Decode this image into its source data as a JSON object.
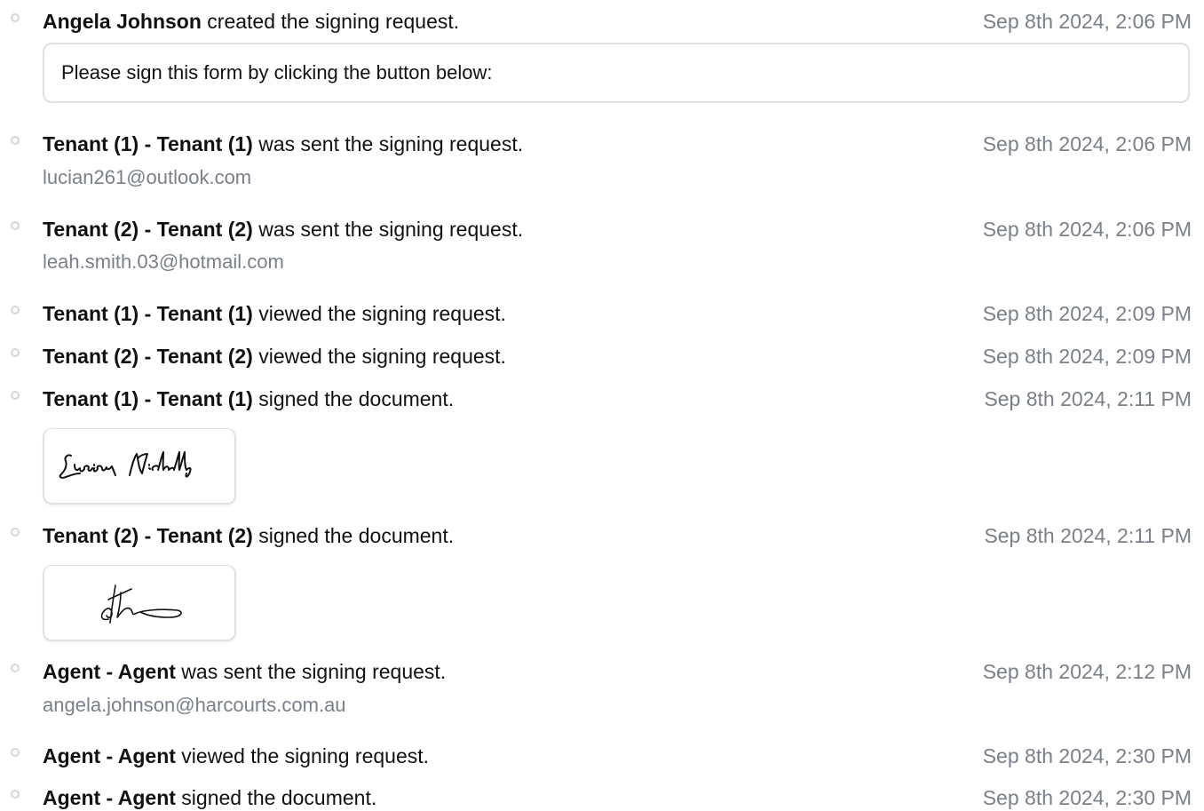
{
  "events": [
    {
      "actor": "Angela Johnson",
      "action": "created the signing request.",
      "time": "Sep 8th 2024, 2:06 PM",
      "message": "Please sign this form by clicking the button below:"
    },
    {
      "actor": "Tenant (1) - Tenant (1)",
      "action": "was sent the signing request.",
      "time": "Sep 8th 2024, 2:06 PM",
      "email": "lucian261@outlook.com"
    },
    {
      "actor": "Tenant (2) - Tenant (2)",
      "action": "was sent the signing request.",
      "time": "Sep 8th 2024, 2:06 PM",
      "email": "leah.smith.03@hotmail.com"
    },
    {
      "actor": "Tenant (1) - Tenant (1)",
      "action": "viewed the signing request.",
      "time": "Sep 8th 2024, 2:09 PM"
    },
    {
      "actor": "Tenant (2) - Tenant (2)",
      "action": "viewed the signing request.",
      "time": "Sep 8th 2024, 2:09 PM"
    },
    {
      "actor": "Tenant (1) - Tenant (1)",
      "action": "signed the document.",
      "time": "Sep 8th 2024, 2:11 PM",
      "signature": "Lucian Nicholls"
    },
    {
      "actor": "Tenant (2) - Tenant (2)",
      "action": "signed the document.",
      "time": "Sep 8th 2024, 2:11 PM"
    },
    {
      "actor": "Agent - Agent",
      "action": "was sent the signing request.",
      "time": "Sep 8th 2024, 2:12 PM",
      "email": "angela.johnson@harcourts.com.au"
    },
    {
      "actor": "Agent - Agent",
      "action": "viewed the signing request.",
      "time": "Sep 8th 2024, 2:30 PM"
    },
    {
      "actor": "Agent - Agent",
      "action": "signed the document.",
      "time": "Sep 8th 2024, 2:30 PM"
    }
  ],
  "colors": {
    "muted_text": "#7a7f88",
    "border": "#dde0e5",
    "dot": "#d3d6dc"
  }
}
